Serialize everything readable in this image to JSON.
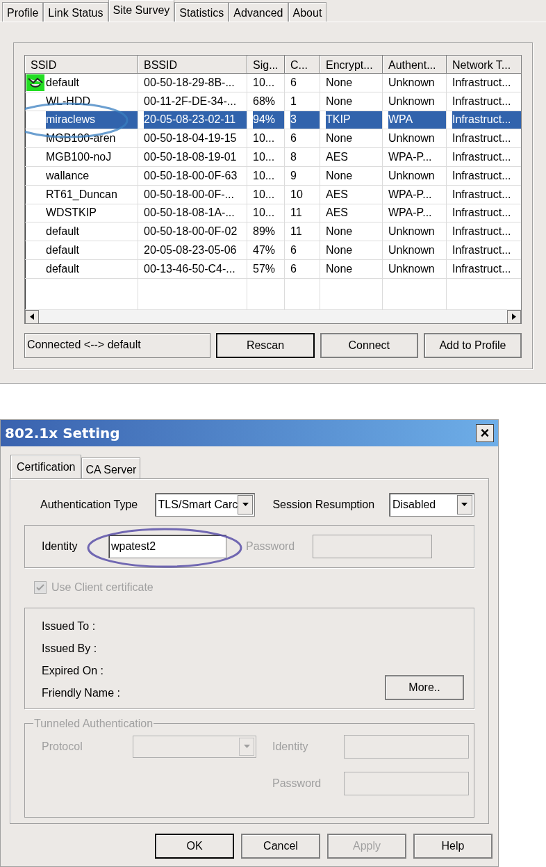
{
  "tabs": [
    {
      "label": "Profile",
      "selected": false
    },
    {
      "label": "Link Status",
      "selected": false
    },
    {
      "label": "Site Survey",
      "selected": true
    },
    {
      "label": "Statistics",
      "selected": false
    },
    {
      "label": "Advanced",
      "selected": false
    },
    {
      "label": "About",
      "selected": false
    }
  ],
  "table": {
    "columns": [
      "SSID",
      "BSSID",
      "Sig...",
      "C...",
      "Encrypt...",
      "Authent...",
      "Network T..."
    ],
    "rows": [
      {
        "cells": [
          "default",
          "00-50-18-29-8B-...",
          "10...",
          "6",
          "None",
          "Unknown",
          "Infrastruct..."
        ],
        "connected": true,
        "selected": false,
        "circled": false
      },
      {
        "cells": [
          "WL-HDD",
          "00-11-2F-DE-34-...",
          "68%",
          "1",
          "None",
          "Unknown",
          "Infrastruct..."
        ],
        "connected": false,
        "selected": false,
        "circled": false
      },
      {
        "cells": [
          "miraclews",
          "20-05-08-23-02-11",
          "94%",
          "3",
          "TKIP",
          "WPA",
          "Infrastruct..."
        ],
        "connected": false,
        "selected": true,
        "circled": true
      },
      {
        "cells": [
          "MGB100-aren",
          "00-50-18-04-19-15",
          "10...",
          "6",
          "None",
          "Unknown",
          "Infrastruct..."
        ],
        "connected": false,
        "selected": false,
        "circled": false
      },
      {
        "cells": [
          "MGB100-noJ",
          "00-50-18-08-19-01",
          "10...",
          "8",
          "AES",
          "WPA-P...",
          "Infrastruct..."
        ],
        "connected": false,
        "selected": false,
        "circled": false
      },
      {
        "cells": [
          "wallance",
          "00-50-18-00-0F-63",
          "10...",
          "9",
          "None",
          "Unknown",
          "Infrastruct..."
        ],
        "connected": false,
        "selected": false,
        "circled": false
      },
      {
        "cells": [
          "RT61_Duncan",
          "00-50-18-00-0F-...",
          "10...",
          "10",
          "AES",
          "WPA-P...",
          "Infrastruct..."
        ],
        "connected": false,
        "selected": false,
        "circled": false
      },
      {
        "cells": [
          "WDSTKIP",
          "00-50-18-08-1A-...",
          "10...",
          "11",
          "AES",
          "WPA-P...",
          "Infrastruct..."
        ],
        "connected": false,
        "selected": false,
        "circled": false
      },
      {
        "cells": [
          "default",
          "00-50-18-00-0F-02",
          "89%",
          "11",
          "None",
          "Unknown",
          "Infrastruct..."
        ],
        "connected": false,
        "selected": false,
        "circled": false
      },
      {
        "cells": [
          "default",
          "20-05-08-23-05-06",
          "47%",
          "6",
          "None",
          "Unknown",
          "Infrastruct..."
        ],
        "connected": false,
        "selected": false,
        "circled": false
      },
      {
        "cells": [
          "default",
          "00-13-46-50-C4-...",
          "57%",
          "6",
          "None",
          "Unknown",
          "Infrastruct..."
        ],
        "connected": false,
        "selected": false,
        "circled": false
      }
    ]
  },
  "status": "Connected <--> default",
  "buttons": [
    "Rescan",
    "Connect",
    "Add to Profile"
  ],
  "dialog": {
    "title": "802.1x Setting",
    "close": "×",
    "tabs": [
      {
        "label": "Certification",
        "selected": true
      },
      {
        "label": "CA Server",
        "selected": false
      }
    ],
    "auth_type": {
      "label": "Authentication Type",
      "value": "TLS/Smart Carc"
    },
    "session": {
      "label": "Session Resumption",
      "value": "Disabled"
    },
    "identity": {
      "label": "Identity",
      "value": "wpatest2",
      "circled": true
    },
    "password": {
      "label": "Password",
      "disabled": true
    },
    "client_cert": {
      "label": "Use Client certificate",
      "checked": true,
      "disabled": true
    },
    "info": [
      "Issued To :",
      "Issued By :",
      "Expired On :",
      "Friendly Name :"
    ],
    "more": "More..",
    "tunneled": {
      "title": "Tunneled Authentication",
      "protocol": "Protocol",
      "identity": "Identity",
      "password": "Password",
      "disabled": true
    },
    "buttons": [
      {
        "label": "OK",
        "disabled": false,
        "default": true
      },
      {
        "label": "Cancel",
        "disabled": false,
        "default": false
      },
      {
        "label": "Apply",
        "disabled": true,
        "default": false
      },
      {
        "label": "Help",
        "disabled": false,
        "default": false
      }
    ]
  }
}
